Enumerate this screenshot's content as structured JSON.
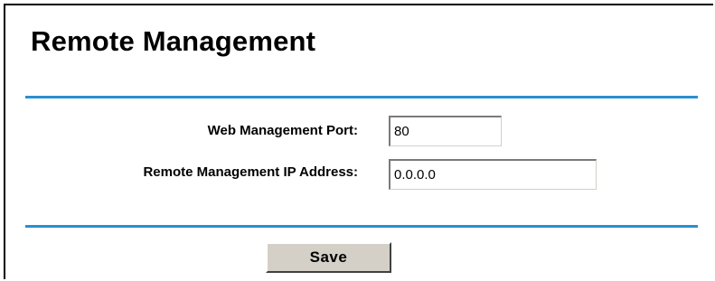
{
  "page": {
    "title": "Remote Management"
  },
  "form": {
    "web_port": {
      "label": "Web Management Port:",
      "value": "80"
    },
    "remote_ip": {
      "label": "Remote Management IP Address:",
      "value": "0.0.0.0"
    }
  },
  "actions": {
    "save_label": "Save"
  },
  "colors": {
    "divider": "#2a8fd1",
    "button_face": "#d4d0c8"
  }
}
